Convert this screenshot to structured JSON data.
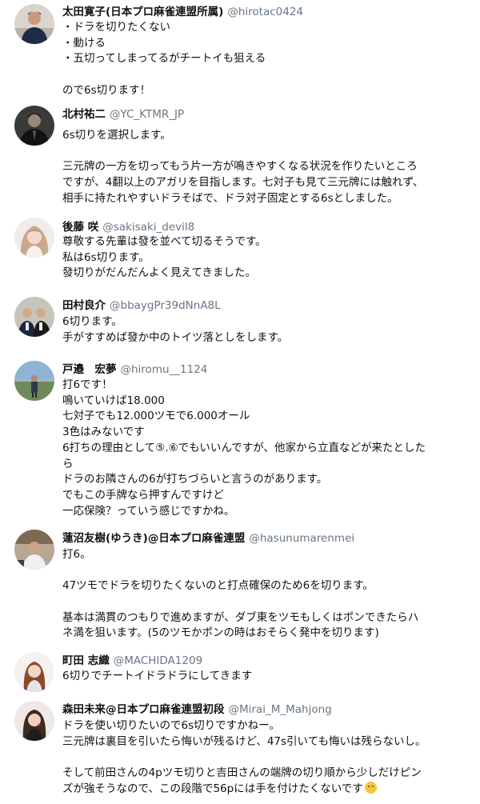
{
  "tweets": [
    {
      "name": "太田寛子(日本プロ麻雀連盟所属)",
      "handle": "@hirotac0424",
      "lines": [
        "・ドラを切りたくない",
        "・動ける",
        "・五切ってしまってるがチートイも狙える",
        "",
        "ので6s切ります！"
      ]
    },
    {
      "name": "北村祐二",
      "handle": "@YC_KTMR_JP",
      "lines": [
        "6s切りを選択します。",
        "",
        "三元牌の一方を切ってもう片一方が鳴きやすくなる状況を作りたいところ",
        "ですが、4翻以上のアガリを目指します。七対子も見て三元牌には触れず、",
        "相手に持たれやすいドラそばで、ドラ対子固定とする6sとしました。"
      ]
    },
    {
      "name": "後藤 咲",
      "handle": "@sakisaki_devil8",
      "lines": [
        "尊敬する先輩は發を並べて切るそうです。",
        "私は6s切ります。",
        "發切りがだんだんよく見えてきました。"
      ]
    },
    {
      "name": "田村良介",
      "handle": "@bbaygPr39dNnA8L",
      "lines": [
        "6切ります。",
        "手がすすめば發か中のトイツ落としをします。"
      ]
    },
    {
      "name": "戸邉　宏夢",
      "handle": "@hiromu__1124",
      "lines": [
        "打6です！",
        "鳴いていけば18.000",
        "七対子でも12.000ツモで6.000オール",
        "3色はみないです",
        "6打ちの理由として⑤.⑥でもいいんですが、他家から立直などが来たとした",
        "ら",
        "ドラのお隣さんの6が打ちづらいと言うのがあります。",
        "でもこの手牌なら押すんですけど",
        "一応保険？っていう感じですかね。"
      ]
    },
    {
      "name": "蓮沼友樹(ゆうき)@日本プロ麻雀連盟",
      "handle": "@hasunumarenmei",
      "lines": [
        "打6。",
        "",
        "47ツモでドラを切りたくないのと打点確保のため6を切ります。",
        "",
        "基本は満貫のつもりで進めますが、ダブ東をツモもしくはポンできたらハ",
        "ネ満を狙います。(5のツモかポンの時はおそらく発中を切ります)"
      ]
    },
    {
      "name": "町田 志織",
      "handle": "@MACHIDA1209",
      "lines": [
        "6切りでチートイドラドラにしてきます"
      ]
    },
    {
      "name": "森田未来@日本プロ麻雀連盟初段",
      "handle": "@Mirai_M_Mahjong",
      "lines": [
        "ドラを使い切りたいので6s切りですかねー。",
        "三元牌は裏目を引いたら悔いが残るけど、47s引いても悔いは残らないし。",
        "",
        "そして前田さんの4pツモ切りと吉田さんの端牌の切り順から少しだけピン",
        "ズが強そうなので、この段階で56pには手を付けたくないです"
      ]
    }
  ],
  "emoji_icon": "thinking-face-icon",
  "colors": {
    "name": "#111111",
    "handle": "#687684",
    "background": "#ffffff"
  }
}
